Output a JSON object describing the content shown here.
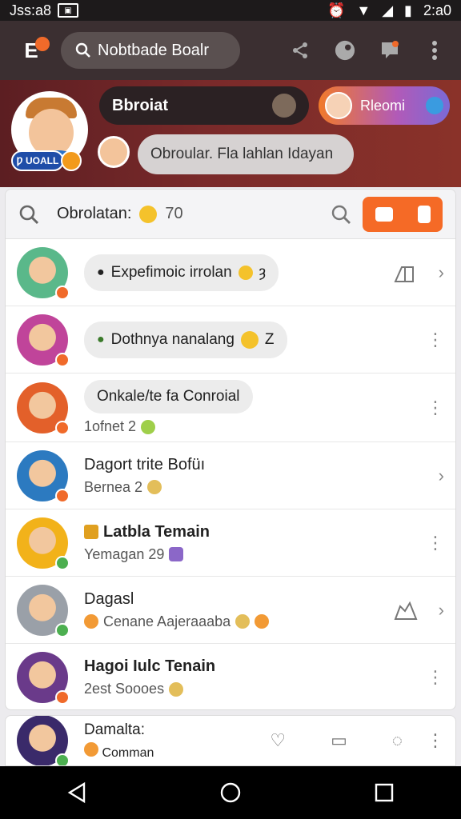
{
  "status": {
    "time_left": "Jss:a8",
    "time_right": "2:a0"
  },
  "appbar": {
    "logo_letter": "E",
    "search_text": "Nobtbade Boalr",
    "icons": [
      "share-icon",
      "sticker-icon",
      "notification-icon",
      "more-vert-icon"
    ]
  },
  "banner": {
    "badge_text": "Ƿ UOALL",
    "name": "Bbroiat",
    "chip_label": "Rleomi",
    "message": "Obroular. Fla lahlan Idayan"
  },
  "list": {
    "title": "Obrolatan:",
    "count": "70"
  },
  "rows": [
    {
      "bubble": "Expefimoic irrolan",
      "trail": "ȝ"
    },
    {
      "bubble": "Dothnya nanalang",
      "trail": "Z"
    },
    {
      "bubble": "Onkale/te fa Conroial",
      "secondary": "1ofnet 2"
    },
    {
      "primary": "Dagort trite Bofüı",
      "secondary": "Bernea 2"
    },
    {
      "primary": "Latbla Temain",
      "secondary": "Yemagan 29"
    },
    {
      "primary": "Dagasl",
      "secondary": "Cenane Aajeraaaba"
    },
    {
      "primary": "Hagoi Iulc Tenain",
      "secondary": "2est Soooes"
    }
  ],
  "bottom_row": {
    "primary": "Damalta:",
    "secondary": "Comman"
  },
  "colors": {
    "accent": "#f56a26",
    "appbar": "#3b2f31",
    "banner": "#6d2626"
  }
}
